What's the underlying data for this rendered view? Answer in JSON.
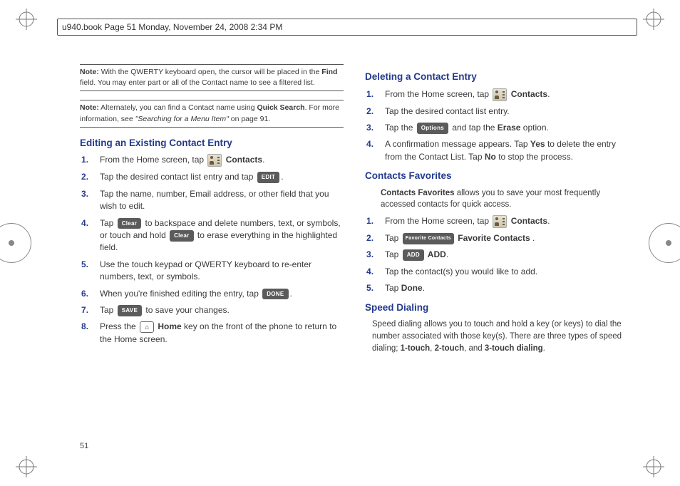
{
  "header": "u940.book  Page 51  Monday, November 24, 2008  2:34 PM",
  "page_number": "51",
  "note1": {
    "label": "Note:",
    "body_a": " With the QWERTY keyboard open, the cursor will be placed in the ",
    "bold_a": "Find",
    "body_b": " field. You may enter part or all of the Contact name to see a filtered list."
  },
  "note2": {
    "label": "Note:",
    "body_a": " Alternately, you can find a Contact name using ",
    "bold_a": "Quick Search",
    "body_b": ". For more information, see ",
    "ital_a": "\"Searching for a Menu Item\"",
    "body_c": " on page 91."
  },
  "sec_edit": {
    "title": "Editing an Existing Contact Entry",
    "s1a": "From the Home screen, tap ",
    "s1b": " Contacts",
    "s1c": ".",
    "s2a": "Tap the desired contact list entry and tap ",
    "s2b": ".",
    "s3": "Tap the name, number, Email address, or other field that you wish to edit.",
    "s4a": "Tap ",
    "s4b": " to backspace and delete numbers, text, or symbols, or touch and hold ",
    "s4c": " to erase everything in the highlighted field.",
    "s5": "Use the touch keypad or QWERTY keyboard to re-enter numbers, text, or symbols.",
    "s6a": "When you're finished editing the entry, tap ",
    "s6b": ".",
    "s7a": "Tap ",
    "s7b": " to save your changes.",
    "s8a": "Press the ",
    "s8b": " Home",
    "s8c": " key on the front of the phone to return to the Home screen."
  },
  "sec_del": {
    "title": "Deleting a Contact Entry",
    "s1a": "From the Home screen, tap ",
    "s1b": " Contacts",
    "s1c": ".",
    "s2": "Tap the desired contact list entry.",
    "s3a": "Tap the ",
    "s3b": " and tap the ",
    "s3c": "Erase",
    "s3d": " option.",
    "s4a": "A confirmation message appears. Tap ",
    "s4b": "Yes",
    "s4c": " to delete the entry from the Contact List. Tap ",
    "s4d": "No",
    "s4e": " to stop the process."
  },
  "sec_fav": {
    "title": "Contacts Favorites",
    "intro_a": "Contacts Favorites",
    "intro_b": " allows you to save your most frequently accessed contacts for quick access.",
    "s1a": "From the Home screen, tap ",
    "s1b": " Contacts",
    "s1c": ".",
    "s2a": "Tap ",
    "s2b": " Favorite Contacts ",
    "s2c": ".",
    "s3a": "Tap ",
    "s3b": " ADD",
    "s3c": ".",
    "s4": "Tap the contact(s) you would like to add.",
    "s5a": "Tap ",
    "s5b": "Done",
    "s5c": "."
  },
  "sec_speed": {
    "title": "Speed Dialing",
    "body_a": "Speed dialing allows you to touch and hold a key (or keys) to dial the number associated with those key(s). There are three types of speed dialing; ",
    "b1": "1-touch",
    "c1": ", ",
    "b2": "2-touch",
    "c2": ", and ",
    "b3": "3-touch dialing",
    "c3": "."
  },
  "pills": {
    "edit": "EDIT",
    "clear": "Clear",
    "done": "DONE",
    "save": "SAVE",
    "options": "Options",
    "favc": "Favorite Contacts",
    "add": "ADD"
  },
  "home_glyph": "⌂"
}
